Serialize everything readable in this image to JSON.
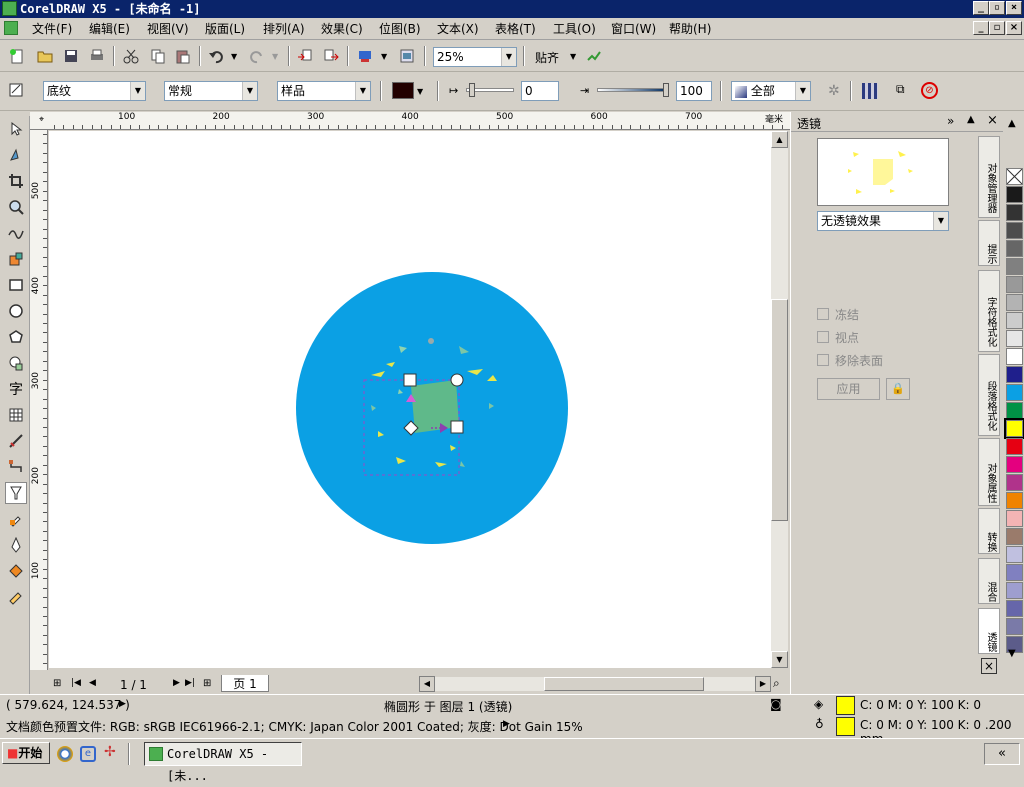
{
  "window": {
    "title": "CorelDRAW X5 - [未命名 -1]"
  },
  "menu": [
    "文件(F)",
    "编辑(E)",
    "视图(V)",
    "版面(L)",
    "排列(A)",
    "效果(C)",
    "位图(B)",
    "文本(X)",
    "表格(T)",
    "工具(O)",
    "窗口(W)",
    "帮助(H)"
  ],
  "toolbar": {
    "zoom": "25%",
    "snap_label": "贴齐"
  },
  "propbar": {
    "texture": "底纹",
    "mode": "常规",
    "sample": "样品",
    "value1": "0",
    "value2": "100",
    "scope": "全部"
  },
  "ruler": {
    "unit": "毫米",
    "h_ticks": [
      "100",
      "200",
      "300",
      "400",
      "500",
      "600",
      "700"
    ],
    "v_ticks": [
      "500",
      "400",
      "300",
      "200",
      "100"
    ]
  },
  "docker": {
    "title": "透镜",
    "lens_effect": "无透镜效果",
    "options": [
      "冻结",
      "视点",
      "移除表面"
    ],
    "apply_label": "应用",
    "tabs": [
      "对象管理器",
      "提示",
      "字符格式化",
      "段落格式化",
      "对象属性",
      "转换",
      "混合",
      "透镜"
    ]
  },
  "colors": {
    "circle": "#0ba0e4",
    "square": "#5fb98a",
    "palette": [
      "#ffffff",
      "#1a1a1a",
      "#333333",
      "#4d4d4d",
      "#666666",
      "#808080",
      "#999999",
      "#b3b3b3",
      "#cccccc",
      "#e6e6e6",
      "#ffffff",
      "#1f1f8c",
      "#0ba0e4",
      "#009245",
      "#ffff00",
      "#e60012",
      "#e4007f",
      "#b0338b",
      "#f08300",
      "#f4b4b4",
      "#9a7b6b",
      "#c0c0e0",
      "#8080c0",
      "#9e9ecf",
      "#6666aa",
      "#7a7aa8",
      "#5c5c8a"
    ]
  },
  "page_nav": {
    "count": "1 / 1",
    "tab": "页 1"
  },
  "status": {
    "coords": "( 579.624, 124.537 )",
    "object": "椭圆形 于 图层 1 (透镜)",
    "fill": "C: 0 M: 0 Y: 100 K: 0",
    "color_profile": "文档颜色预置文件: RGB: sRGB IEC61966-2.1; CMYK: Japan Color 2001 Coated; 灰度: Dot Gain 15%",
    "outline": "C: 0 M: 0 Y: 100 K: 0  .200 mm"
  },
  "taskbar": {
    "start": "开始",
    "task": "CorelDRAW X5 - [未..."
  }
}
